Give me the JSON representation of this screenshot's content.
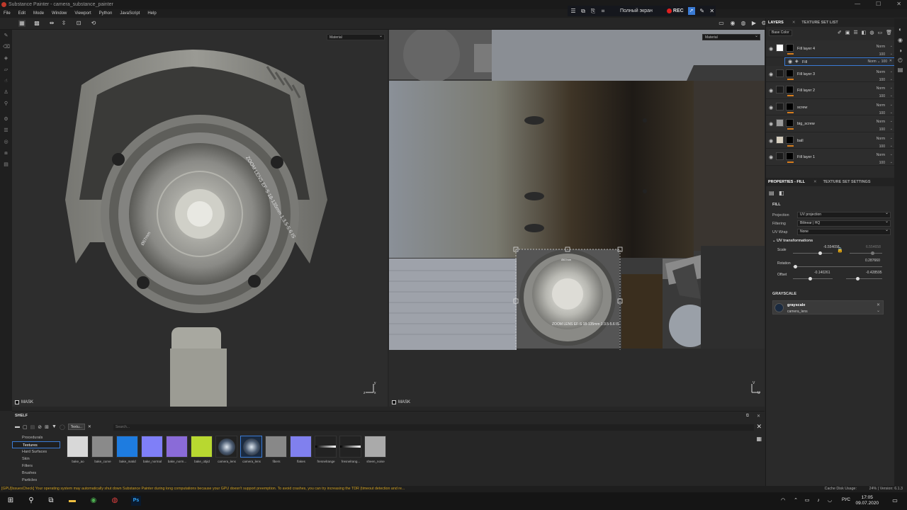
{
  "window": {
    "title": "Substance Painter - camera_substance_painter",
    "controls": [
      "—",
      "☐",
      "✕"
    ]
  },
  "menu": [
    "File",
    "Edit",
    "Mode",
    "Window",
    "Viewport",
    "Python",
    "JavaScript",
    "Help"
  ],
  "recbar": {
    "fullscreen": "Полный экран",
    "rec": "REC"
  },
  "viewport3d": {
    "channel": "Material",
    "mask": "MASK"
  },
  "viewport2d": {
    "channel": "Material",
    "mask": "MASK"
  },
  "lens_text": {
    "ring": "ZOOM LENS EF-S 18-135mm 1:3.5-5.6 IS",
    "size": "Ø67mm",
    "uv_ring": "ZOOM LENS EF-S 18-135mm 1:3.5-5.6 IS",
    "uv_small": "Ø67mm"
  },
  "layers_panel": {
    "tabs": [
      "LAYERS",
      "TEXTURE SET LIST"
    ],
    "channel": "Base Color",
    "layers": [
      {
        "name": "Fill layer 4",
        "blend": "Norm",
        "opacity": "100",
        "thumb": "#ffffff"
      },
      {
        "name": "Fill",
        "blend": "Norm",
        "opacity": "100",
        "sub": true
      },
      {
        "name": "Fill layer 3",
        "blend": "Norm",
        "opacity": "100",
        "thumb": "#1a1a1a"
      },
      {
        "name": "Fill layer 2",
        "blend": "Norm",
        "opacity": "100",
        "thumb": "#1a1a1a"
      },
      {
        "name": "screw",
        "blend": "Norm",
        "opacity": "100",
        "thumb": "#1a1a1a"
      },
      {
        "name": "big_screw",
        "blend": "Norm",
        "opacity": "100",
        "thumb": "#9a9a9a"
      },
      {
        "name": "ball",
        "blend": "Norm",
        "opacity": "100",
        "thumb": "#d8d0c0"
      },
      {
        "name": "Fill layer 1",
        "blend": "Norm",
        "opacity": "100",
        "thumb": "#1a1a1a"
      }
    ]
  },
  "properties": {
    "tabs": [
      "PROPERTIES - FILL",
      "TEXTURE SET SETTINGS"
    ],
    "section_fill": "FILL",
    "projection_label": "Projection",
    "projection": "UV projection",
    "filtering_label": "Filtering",
    "filtering": "Bilinear | HQ",
    "uvwrap_label": "UV Wrap",
    "uvwrap": "None",
    "uv_transform": "UV transformations",
    "scale_label": "Scale",
    "scale_a": "-6.554658",
    "scale_b": "6.554658",
    "rotation_label": "Rotation",
    "rotation": "0.287660",
    "offset_label": "Offset",
    "offset_a": "-0.140261",
    "offset_b": "-0.428595",
    "section_grayscale": "GRAYSCALE",
    "grayscale_name": "grayscale",
    "grayscale_source": "camera_lens"
  },
  "shelf": {
    "title": "SHELF",
    "filter_chip": "Textu...",
    "search_placeholder": "Search...",
    "categories": [
      "Procedurals",
      "Textures",
      "Hard Surfaces",
      "Skin",
      "Filters",
      "Brushes",
      "Particles"
    ],
    "selected_category": "Textures",
    "items": [
      {
        "name": "bake_ao",
        "color": "#d8d8d8"
      },
      {
        "name": "bake_curve",
        "color": "#8a8a8a"
      },
      {
        "name": "bake_matid",
        "color": "#1e7ce0"
      },
      {
        "name": "bake_normal",
        "color": "#7f7ff8"
      },
      {
        "name": "bake_norm...",
        "color": "#8a6bd8"
      },
      {
        "name": "bake_objid",
        "color": "#b8d830"
      },
      {
        "name": "camera_lens",
        "color": "#222222"
      },
      {
        "name": "camera_lens",
        "color": "#1a2a40"
      },
      {
        "name": "fibers",
        "color": "#888888"
      },
      {
        "name": "flakes",
        "color": "#8080ee"
      },
      {
        "name": "fresnelrange",
        "color": "#333333"
      },
      {
        "name": "fresnelrang...",
        "color": "#444444"
      },
      {
        "name": "sheen_noise",
        "color": "#aaaaaa"
      }
    ]
  },
  "status": {
    "warning": "[GPU]IssuesCheck] Your operating system may automatically shut down Substance Painter during long computations because your GPU doesn't support preemption. To avoid crashes, you can try increasing the TDR (timeout detection and re...",
    "cache": "Cache Disk Usage:",
    "cache_pct": "24%",
    "version": "Version: 6.1.3"
  },
  "taskbar": {
    "lang": "РУС",
    "time": "17:05",
    "date": "09.07.2020"
  }
}
